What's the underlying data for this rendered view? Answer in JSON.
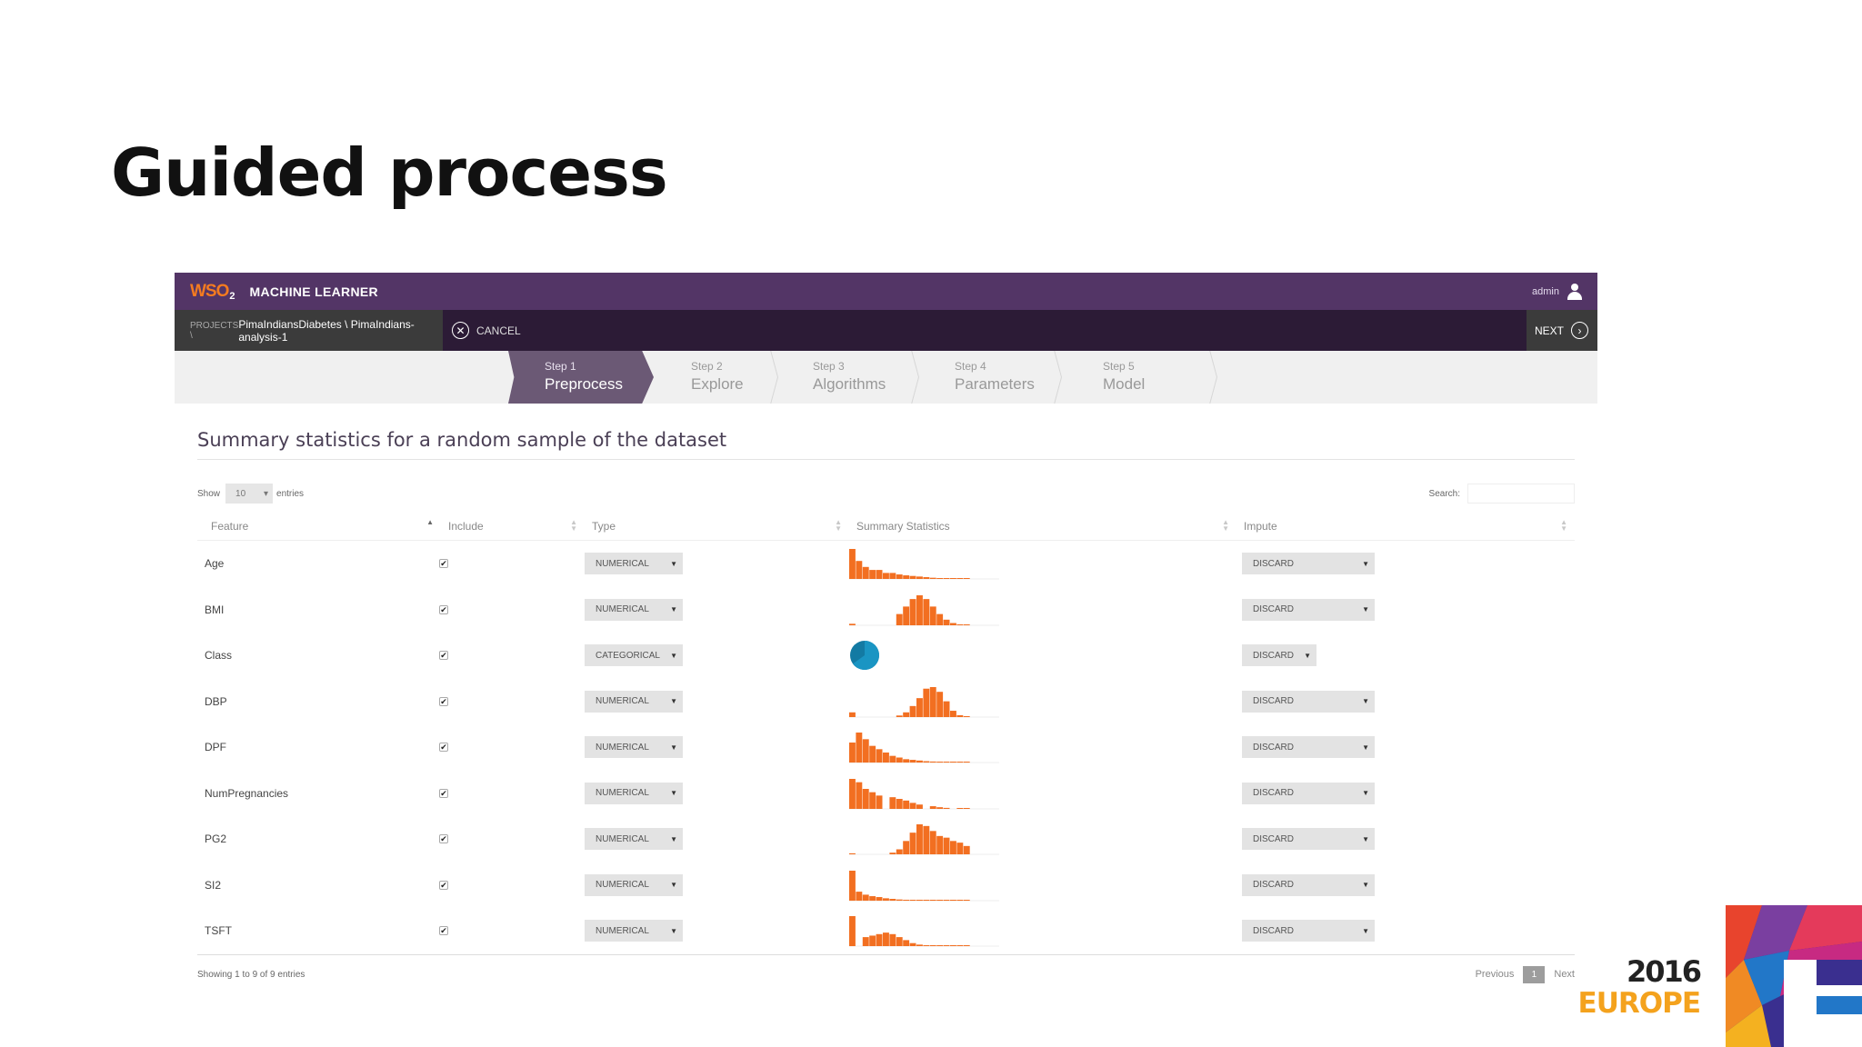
{
  "slide": {
    "title": "Guided process"
  },
  "app": {
    "logo": "WSO",
    "logo_sub": "2",
    "name": "MACHINE LEARNER",
    "user": "admin",
    "breadcrumb_prefix": "PROJECTS \\ ",
    "breadcrumb_path": "PimaIndiansDiabetes \\ PimaIndians-analysis-1",
    "cancel_label": "CANCEL",
    "next_label": "NEXT",
    "colors": {
      "topbar": "#533566",
      "subbar": "#2c1b36",
      "active_step": "#6b5975",
      "histogram": "#f26f21",
      "pie": "#1a95c3"
    }
  },
  "steps": [
    {
      "num": "Step 1",
      "name": "Preprocess",
      "active": true
    },
    {
      "num": "Step 2",
      "name": "Explore",
      "active": false
    },
    {
      "num": "Step 3",
      "name": "Algorithms",
      "active": false
    },
    {
      "num": "Step 4",
      "name": "Parameters",
      "active": false
    },
    {
      "num": "Step 5",
      "name": "Model",
      "active": false
    }
  ],
  "main": {
    "section_title": "Summary statistics for a random sample of the dataset",
    "show_label": "Show",
    "show_value": "10",
    "entries_label": "entries",
    "search_label": "Search:",
    "columns": [
      "Feature",
      "Include",
      "Type",
      "Summary Statistics",
      "Impute"
    ],
    "rows": [
      {
        "feature": "Age",
        "include": true,
        "type": "NUMERICAL",
        "impute": "DISCARD",
        "hist": [
          10,
          6,
          4,
          3,
          3,
          2,
          2,
          1.5,
          1.2,
          1,
          0.8,
          0.6,
          0.4,
          0.3,
          0.2,
          0.15,
          0.1,
          0.1
        ]
      },
      {
        "feature": "BMI",
        "include": true,
        "type": "NUMERICAL",
        "impute": "DISCARD",
        "hist": [
          0.4,
          0,
          0,
          0,
          0,
          0,
          0,
          3,
          5,
          7,
          8,
          7,
          5,
          3,
          1.5,
          0.6,
          0.2,
          0.1
        ]
      },
      {
        "feature": "Class",
        "include": true,
        "type": "CATEGORICAL",
        "impute": "DISCARD",
        "pie": [
          65,
          35
        ]
      },
      {
        "feature": "DBP",
        "include": true,
        "type": "NUMERICAL",
        "impute": "DISCARD",
        "hist": [
          1.5,
          0,
          0,
          0,
          0,
          0,
          0,
          0.5,
          1.5,
          3.5,
          6,
          9,
          9.5,
          8,
          5,
          2,
          0.6,
          0.3
        ]
      },
      {
        "feature": "DPF",
        "include": true,
        "type": "NUMERICAL",
        "impute": "DISCARD",
        "hist": [
          6,
          9,
          7,
          5,
          4,
          3,
          2,
          1.5,
          1,
          0.8,
          0.6,
          0.4,
          0.3,
          0.2,
          0.2,
          0.15,
          0.1,
          0.1
        ]
      },
      {
        "feature": "NumPregnancies",
        "include": true,
        "type": "NUMERICAL",
        "impute": "DISCARD",
        "hist": [
          9,
          8,
          6,
          5,
          4,
          0,
          3.5,
          3,
          2.5,
          1.8,
          1.3,
          0,
          0.8,
          0.5,
          0.3,
          0,
          0.15,
          0.1
        ]
      },
      {
        "feature": "PG2",
        "include": true,
        "type": "NUMERICAL",
        "impute": "DISCARD",
        "hist": [
          0.3,
          0,
          0,
          0,
          0,
          0,
          0.5,
          1.5,
          4,
          6.5,
          9,
          8.5,
          7,
          5.5,
          5,
          4,
          3.5,
          2.5
        ]
      },
      {
        "feature": "SI2",
        "include": true,
        "type": "NUMERICAL",
        "impute": "DISCARD",
        "hist": [
          10,
          3,
          2,
          1.5,
          1.2,
          0.8,
          0.6,
          0.4,
          0.3,
          0.25,
          0.2,
          0.15,
          0.1,
          0.1,
          0.05,
          0.05,
          0.05,
          0.05
        ]
      },
      {
        "feature": "TSFT",
        "include": true,
        "type": "NUMERICAL",
        "impute": "DISCARD",
        "hist": [
          10,
          0,
          3,
          3.5,
          4,
          4.5,
          4,
          3,
          2,
          1,
          0.5,
          0.3,
          0.2,
          0.1,
          0.05,
          0.05,
          0.05,
          0.05
        ]
      }
    ],
    "showing_text": "Showing 1 to 9 of 9 entries",
    "prev_label": "Previous",
    "page_current": "1",
    "next_page_label": "Next"
  },
  "brand": {
    "year": "2016",
    "region": "EUROPE"
  }
}
